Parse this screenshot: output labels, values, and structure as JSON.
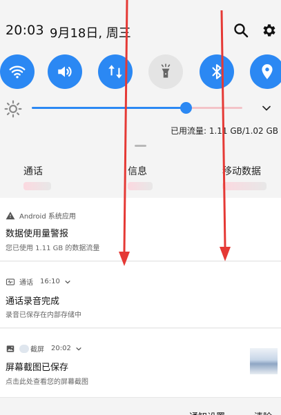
{
  "header": {
    "time": "20:03",
    "date": "9月18日, 周三"
  },
  "quick_settings": [
    {
      "name": "wifi",
      "active": true
    },
    {
      "name": "sound",
      "active": true
    },
    {
      "name": "mobile-data",
      "active": true
    },
    {
      "name": "flashlight",
      "active": false
    },
    {
      "name": "bluetooth",
      "active": true
    },
    {
      "name": "location",
      "active": true
    }
  ],
  "brightness": {
    "level": 0.73
  },
  "data_usage": "已用流量: 1.11 GB/1.02 GB",
  "tabs": [
    {
      "label": "通话"
    },
    {
      "label": "信息"
    },
    {
      "label": "移动数据"
    }
  ],
  "notifications": [
    {
      "app": "Android 系统应用",
      "title": "数据使用量警报",
      "body": "您已使用 1.11 GB 的数据流量"
    },
    {
      "app": "通话",
      "time": "16:10",
      "title": "通话录音完成",
      "body": "录音已保存在内部存储中"
    },
    {
      "app": "截屏",
      "time": "20:02",
      "title": "屏幕截图已保存",
      "body": "点击此处查看您的屏幕截图"
    }
  ],
  "actions": {
    "settings": "通知设置",
    "clear": "清除"
  },
  "colors": {
    "accent": "#2b88f3",
    "arrow": "#e53935"
  }
}
